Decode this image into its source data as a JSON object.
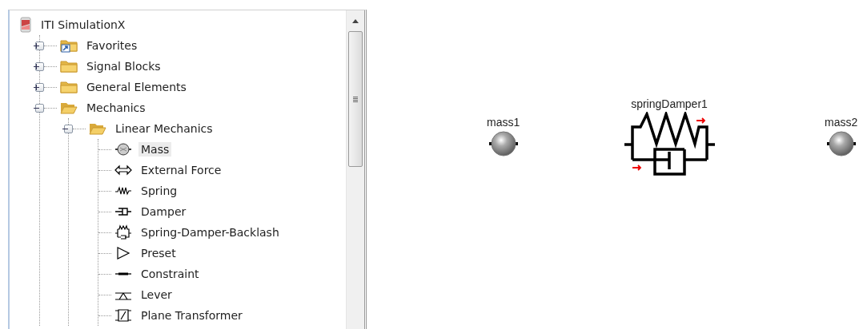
{
  "tree": {
    "label": "ITI SimulationX",
    "kind": "app",
    "children": [
      {
        "label": "Favorites",
        "kind": "favorites",
        "expanded": false,
        "selected": false
      },
      {
        "label": "Signal Blocks",
        "kind": "folder",
        "expanded": false,
        "selected": false
      },
      {
        "label": "General Elements",
        "kind": "folder",
        "expanded": false,
        "selected": false
      },
      {
        "label": "Mechanics",
        "kind": "folder",
        "expanded": true,
        "selected": false,
        "children": [
          {
            "label": "Linear Mechanics",
            "kind": "folder",
            "expanded": true,
            "selected": false,
            "children": [
              {
                "label": "Mass",
                "kind": "mass",
                "selected": true
              },
              {
                "label": "External Force",
                "kind": "force",
                "selected": false
              },
              {
                "label": "Spring",
                "kind": "spring",
                "selected": false
              },
              {
                "label": "Damper",
                "kind": "damper",
                "selected": false
              },
              {
                "label": "Spring-Damper-Backlash",
                "kind": "backlash",
                "selected": false
              },
              {
                "label": "Preset",
                "kind": "preset",
                "selected": false
              },
              {
                "label": "Constraint",
                "kind": "constraint",
                "selected": false
              },
              {
                "label": "Lever",
                "kind": "lever",
                "selected": false
              },
              {
                "label": "Plane Transformer",
                "kind": "plane",
                "selected": false
              }
            ]
          }
        ]
      }
    ]
  },
  "canvas": {
    "components": [
      {
        "label": "mass1",
        "kind": "mass"
      },
      {
        "label": "springDamper1",
        "kind": "springdamper"
      },
      {
        "label": "mass2",
        "kind": "mass"
      }
    ]
  }
}
